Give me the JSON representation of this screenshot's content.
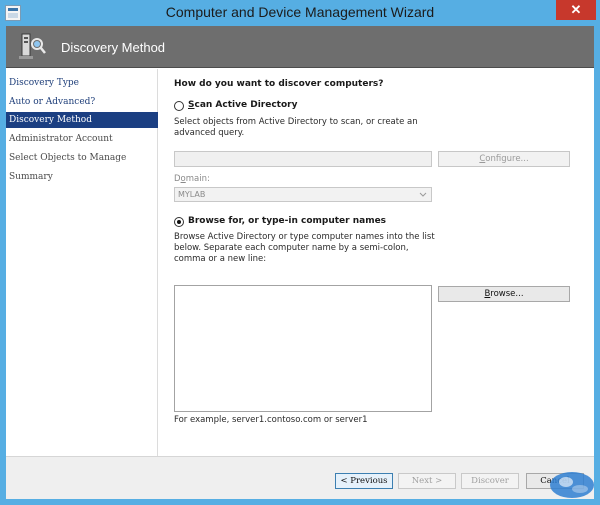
{
  "window": {
    "title": "Computer and Device Management Wizard",
    "close_glyph": "✕"
  },
  "header": {
    "title": "Discovery Method",
    "icon": "discovery-wizard-icon"
  },
  "nav": {
    "items": [
      {
        "label": "Discovery Type",
        "state": "link"
      },
      {
        "label": "Auto or Advanced?",
        "state": "link"
      },
      {
        "label": "Discovery Method",
        "state": "selected"
      },
      {
        "label": "Administrator Account",
        "state": "plain"
      },
      {
        "label": "Select Objects to Manage",
        "state": "plain"
      },
      {
        "label": "Summary",
        "state": "plain"
      }
    ]
  },
  "main": {
    "question": "How do you want to discover computers?",
    "scan_ad": {
      "label_accel": "S",
      "label_rest": "can Active Directory",
      "selected": false,
      "description": "Select objects from Active Directory to scan, or create an advanced query.",
      "query_value": "",
      "configure_accel": "C",
      "configure_rest": "onfigure...",
      "domain_label_pre": "D",
      "domain_label_accel": "o",
      "domain_label_rest": "main:",
      "domain_value": "MYLAB"
    },
    "browse": {
      "label": "Browse for, or type-in computer names",
      "selected": true,
      "description": "Browse Active Directory or type computer names into the list below. Separate each computer name by a semi-colon, comma or a new line:",
      "names_value": "",
      "browse_accel": "B",
      "browse_rest": "rowse...",
      "example": "For example, server1.contoso.com or server1"
    }
  },
  "footer": {
    "previous": "< Previous",
    "next": "Next >",
    "discover": "Discover",
    "cancel": "Cancel"
  },
  "colors": {
    "titlebar": "#56aee3",
    "header_band": "#6e6e6e",
    "nav_selected": "#1b3f82",
    "nav_link": "#1f3f7a",
    "close": "#c7382c"
  }
}
